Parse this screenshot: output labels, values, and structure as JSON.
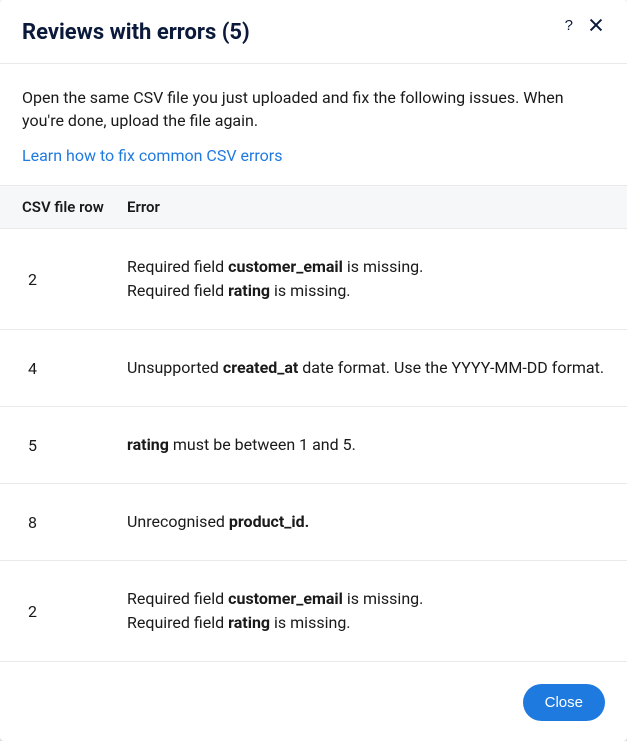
{
  "title": "Reviews with errors (5)",
  "help_icon_label": "Help",
  "close_icon_label": "Close",
  "intro_text": "Open the same CSV file you just uploaded and fix the following issues. When you're done, upload the file again.",
  "learn_link": "Learn how to fix common CSV errors",
  "table": {
    "header_row": "CSV file row",
    "header_error": "Error",
    "rows": [
      {
        "csv_row": "2",
        "lines": [
          {
            "seg": [
              "Required field ",
              "customer_email",
              " is missing."
            ]
          },
          {
            "seg": [
              "Required field ",
              "rating",
              " is missing."
            ]
          }
        ]
      },
      {
        "csv_row": "4",
        "lines": [
          {
            "seg": [
              "Unsupported ",
              "created_at",
              " date format. Use the YYYY-MM-DD format."
            ]
          }
        ]
      },
      {
        "csv_row": "5",
        "lines": [
          {
            "seg": [
              "",
              "rating",
              " must be between 1 and 5."
            ]
          }
        ]
      },
      {
        "csv_row": "8",
        "lines": [
          {
            "seg": [
              "Unrecognised ",
              "product_id.",
              ""
            ]
          }
        ]
      },
      {
        "csv_row": "2",
        "lines": [
          {
            "seg": [
              "Required field ",
              "customer_email",
              " is missing."
            ]
          },
          {
            "seg": [
              "Required field ",
              "rating",
              " is missing."
            ]
          }
        ]
      }
    ]
  },
  "close_button": "Close"
}
